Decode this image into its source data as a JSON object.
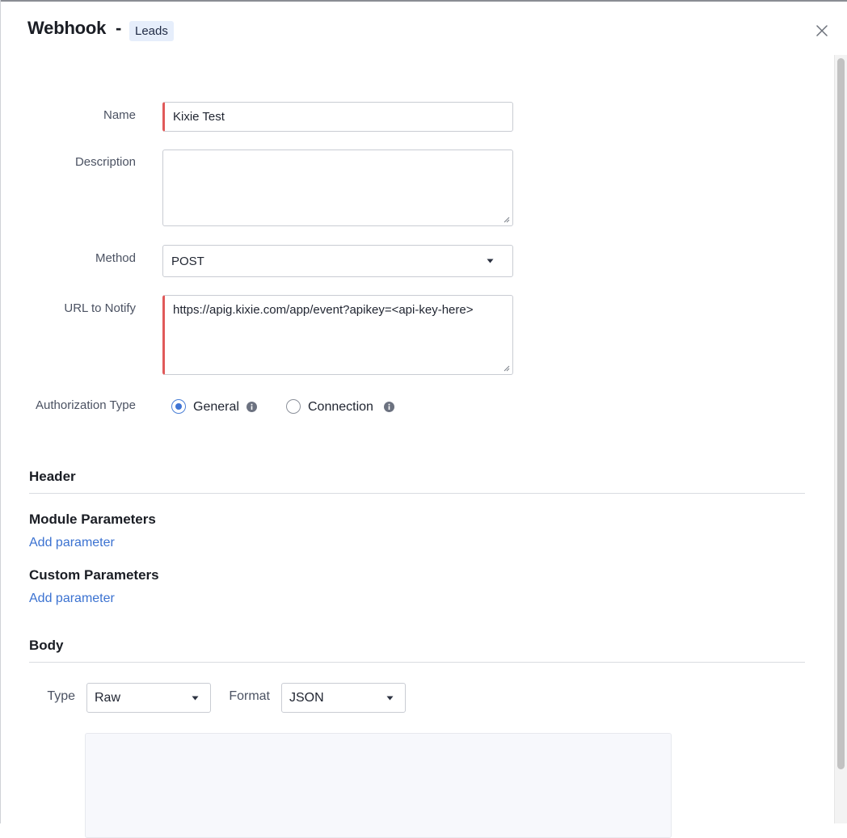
{
  "dialog": {
    "title": "Webhook",
    "separator": "-",
    "module_badge": "Leads",
    "close_icon": "close-icon"
  },
  "form": {
    "name": {
      "label": "Name",
      "value": "Kixie Test"
    },
    "description": {
      "label": "Description",
      "value": ""
    },
    "method": {
      "label": "Method",
      "value": "POST"
    },
    "url": {
      "label": "URL to Notify",
      "value": "https://apig.kixie.com/app/event?apikey=<api-key-here>"
    },
    "authorization": {
      "label": "Authorization Type",
      "options": [
        {
          "label": "General",
          "selected": true
        },
        {
          "label": "Connection",
          "selected": false
        }
      ]
    }
  },
  "header_section": {
    "title": "Header",
    "module_parameters": {
      "title": "Module Parameters",
      "link": "Add parameter"
    },
    "custom_parameters": {
      "title": "Custom Parameters",
      "link": "Add parameter"
    }
  },
  "body_section": {
    "title": "Body",
    "type": {
      "label": "Type",
      "value": "Raw"
    },
    "format": {
      "label": "Format",
      "value": "JSON"
    },
    "content": ""
  },
  "colors": {
    "accent": "#3f74d4",
    "required_marker": "#e05a5a",
    "badge_bg": "#e6eefb",
    "link": "#3b72d1"
  }
}
